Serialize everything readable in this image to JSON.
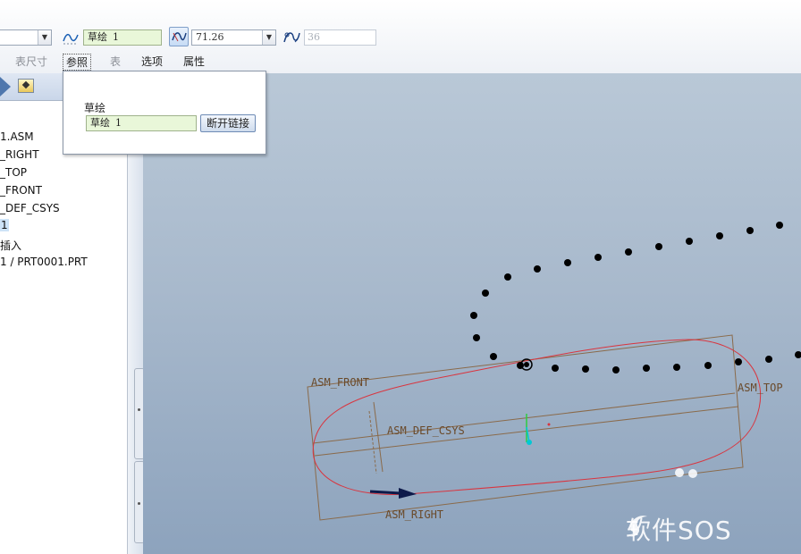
{
  "toolbar": {
    "type_combo_value": "",
    "sketch_field_label": "草绘",
    "sketch_field_number": "1",
    "angle_value": "71.26",
    "disabled_value": "36",
    "tabs": [
      "表尺寸",
      "参照",
      "表",
      "选项",
      "属性"
    ]
  },
  "model_tree": {
    "items": [
      "1.ASM",
      "_RIGHT",
      "_TOP",
      "_FRONT",
      "_DEF_CSYS",
      "1",
      "插入",
      "1 / PRT0001.PRT"
    ]
  },
  "references_panel": {
    "title": "草绘",
    "field_label": "草绘",
    "field_number": "1",
    "unlink_button": "断开链接"
  },
  "graphics": {
    "datum_labels": {
      "front": "ASM_FRONT",
      "top": "ASM_TOP",
      "csys": "ASM_DEF_CSYS",
      "right": "ASM_RIGHT"
    },
    "curve_color": "#d9353f",
    "datum_color": "#8a6a4a"
  },
  "watermark": "软件SOS"
}
